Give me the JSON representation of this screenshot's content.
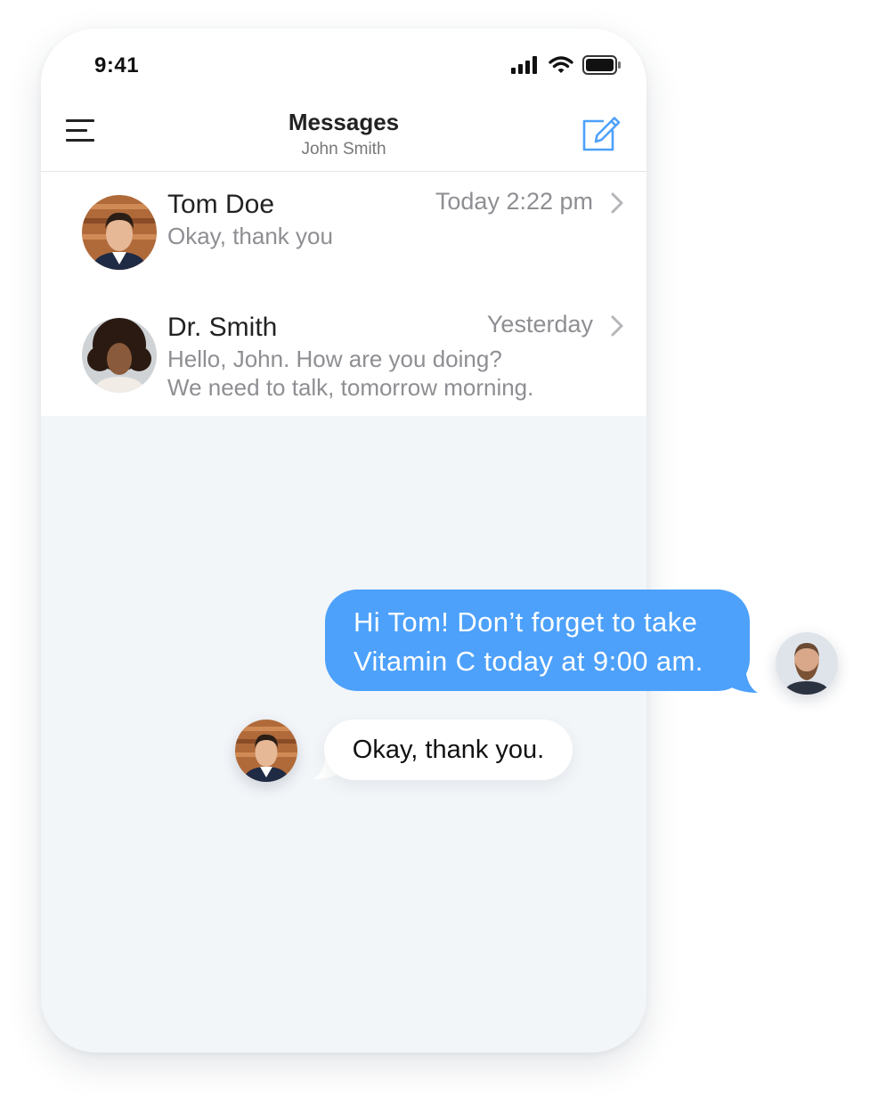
{
  "status_bar": {
    "time": "9:41",
    "icons": [
      "signal-icon",
      "wifi-icon",
      "battery-icon"
    ]
  },
  "header": {
    "menu_icon": "hamburger-menu-icon",
    "title": "Messages",
    "subtitle": "John Smith",
    "compose_icon": "compose-edit-icon"
  },
  "conversations": [
    {
      "name": "Tom Doe",
      "time": "Today 2:22 pm",
      "preview": [
        "Okay, thank you"
      ],
      "avatar": "tom-doe-avatar"
    },
    {
      "name": "Dr. Smith",
      "time": "Yesterday",
      "preview": [
        "Hello, John. How are you doing?",
        "We need to talk, tomorrow morning."
      ],
      "avatar": "dr-smith-avatar"
    }
  ],
  "chat": {
    "outgoing": {
      "lines": [
        "Hi Tom! Don’t forget to take",
        "Vitamin C today at 9:00 am."
      ],
      "avatar": "bearded-man-avatar"
    },
    "incoming": {
      "text": "Okay, thank you.",
      "avatar": "tom-doe-avatar"
    }
  },
  "colors": {
    "accent": "#4da1fb",
    "background": "#f3f6f9",
    "secondary_text": "#8e8e93",
    "primary_text": "#222222"
  }
}
